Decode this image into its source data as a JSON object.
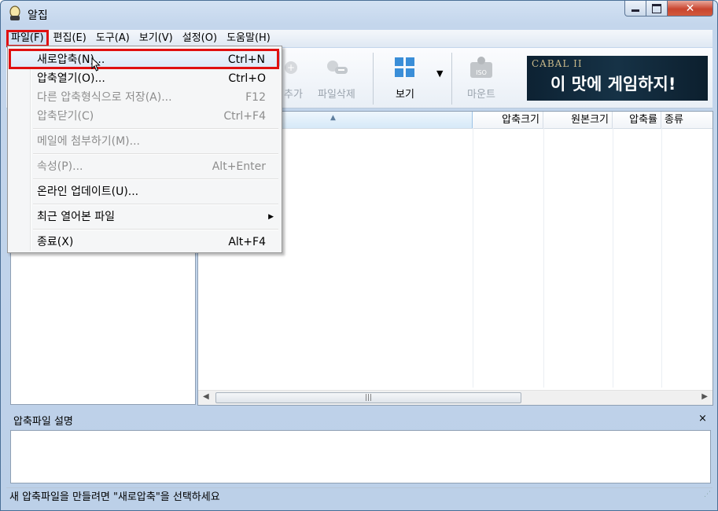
{
  "window": {
    "title": "알집"
  },
  "menubar": {
    "items": [
      "파일(F)",
      "편집(E)",
      "도구(A)",
      "보기(V)",
      "설정(O)",
      "도움말(H)"
    ]
  },
  "toolbar": {
    "add_label": "추가",
    "delete_label": "파일삭제",
    "view_label": "보기",
    "mount_label": "마운트",
    "iso_text": "ISO"
  },
  "ad": {
    "logo": "CABAL II",
    "text": "이 맛에 게임하지!"
  },
  "file_list": {
    "columns": [
      "압축크기",
      "원본크기",
      "압축률",
      "종류"
    ]
  },
  "description": {
    "title": "압축파일 설명",
    "close": "×"
  },
  "status": {
    "text": "새 압축파일을 만들려면 \"새로압축\"을 선택하세요"
  },
  "file_menu": {
    "items": [
      {
        "label": "새로압축(N)...",
        "shortcut": "Ctrl+N"
      },
      {
        "label": "압축열기(O)...",
        "shortcut": "Ctrl+O"
      },
      {
        "label": "다른 압축형식으로 저장(A)...",
        "shortcut": "F12"
      },
      {
        "label": "압축닫기(C)",
        "shortcut": "Ctrl+F4"
      },
      {
        "label": "메일에 첨부하기(M)...",
        "shortcut": ""
      },
      {
        "label": "속성(P)...",
        "shortcut": "Alt+Enter"
      },
      {
        "label": "온라인 업데이트(U)...",
        "shortcut": ""
      },
      {
        "label": "최근 열어본 파일",
        "shortcut": ""
      },
      {
        "label": "종료(X)",
        "shortcut": "Alt+F4"
      }
    ]
  }
}
